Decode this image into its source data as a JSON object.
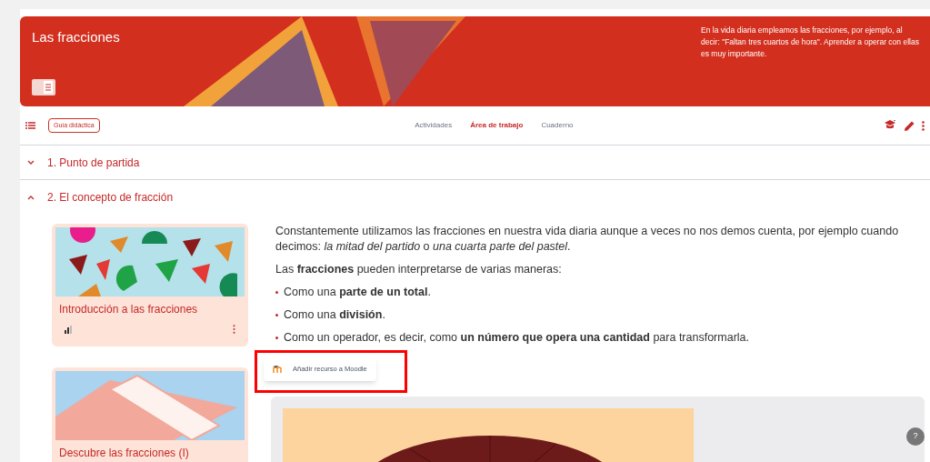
{
  "banner": {
    "title": "Las fracciones",
    "description": "En la vida diaria empleamos las fracciones, por ejemplo, al decir: \"Faltan tres cuartos de hora\". Aprender a operar con ellas es muy importante."
  },
  "toolbar": {
    "guide_button": "Guía didáctica",
    "tabs": [
      {
        "label": "Actividades",
        "selected": false
      },
      {
        "label": "Área de trabajo",
        "selected": true
      },
      {
        "label": "Cuaderno",
        "selected": false
      }
    ]
  },
  "sections": [
    {
      "title": "1. Punto de partida",
      "expanded": false
    },
    {
      "title": "2. El concepto de fracción",
      "expanded": true
    }
  ],
  "cards": [
    {
      "title": "Introducción a las fracciones"
    },
    {
      "title": "Descubre las fracciones (I)"
    }
  ],
  "context_menu": {
    "item": "Añadir recurso a Moodle"
  },
  "content": {
    "paragraphs": [
      "Constantemente utilizamos las fracciones en nuestra vida diaria aunque a veces no nos demos cuenta, por ejemplo cuando decimos: *la mitad del partido* o *una cuarta parte del pastel*.",
      "Las **fracciones** pueden interpretarse de varias maneras:"
    ],
    "bullets": [
      "Como una **parte de un total**.",
      "Como una **división**.",
      "Como un operador, es decir, como **un número que opera una cantidad** para transformarla."
    ]
  },
  "help_button": "?"
}
